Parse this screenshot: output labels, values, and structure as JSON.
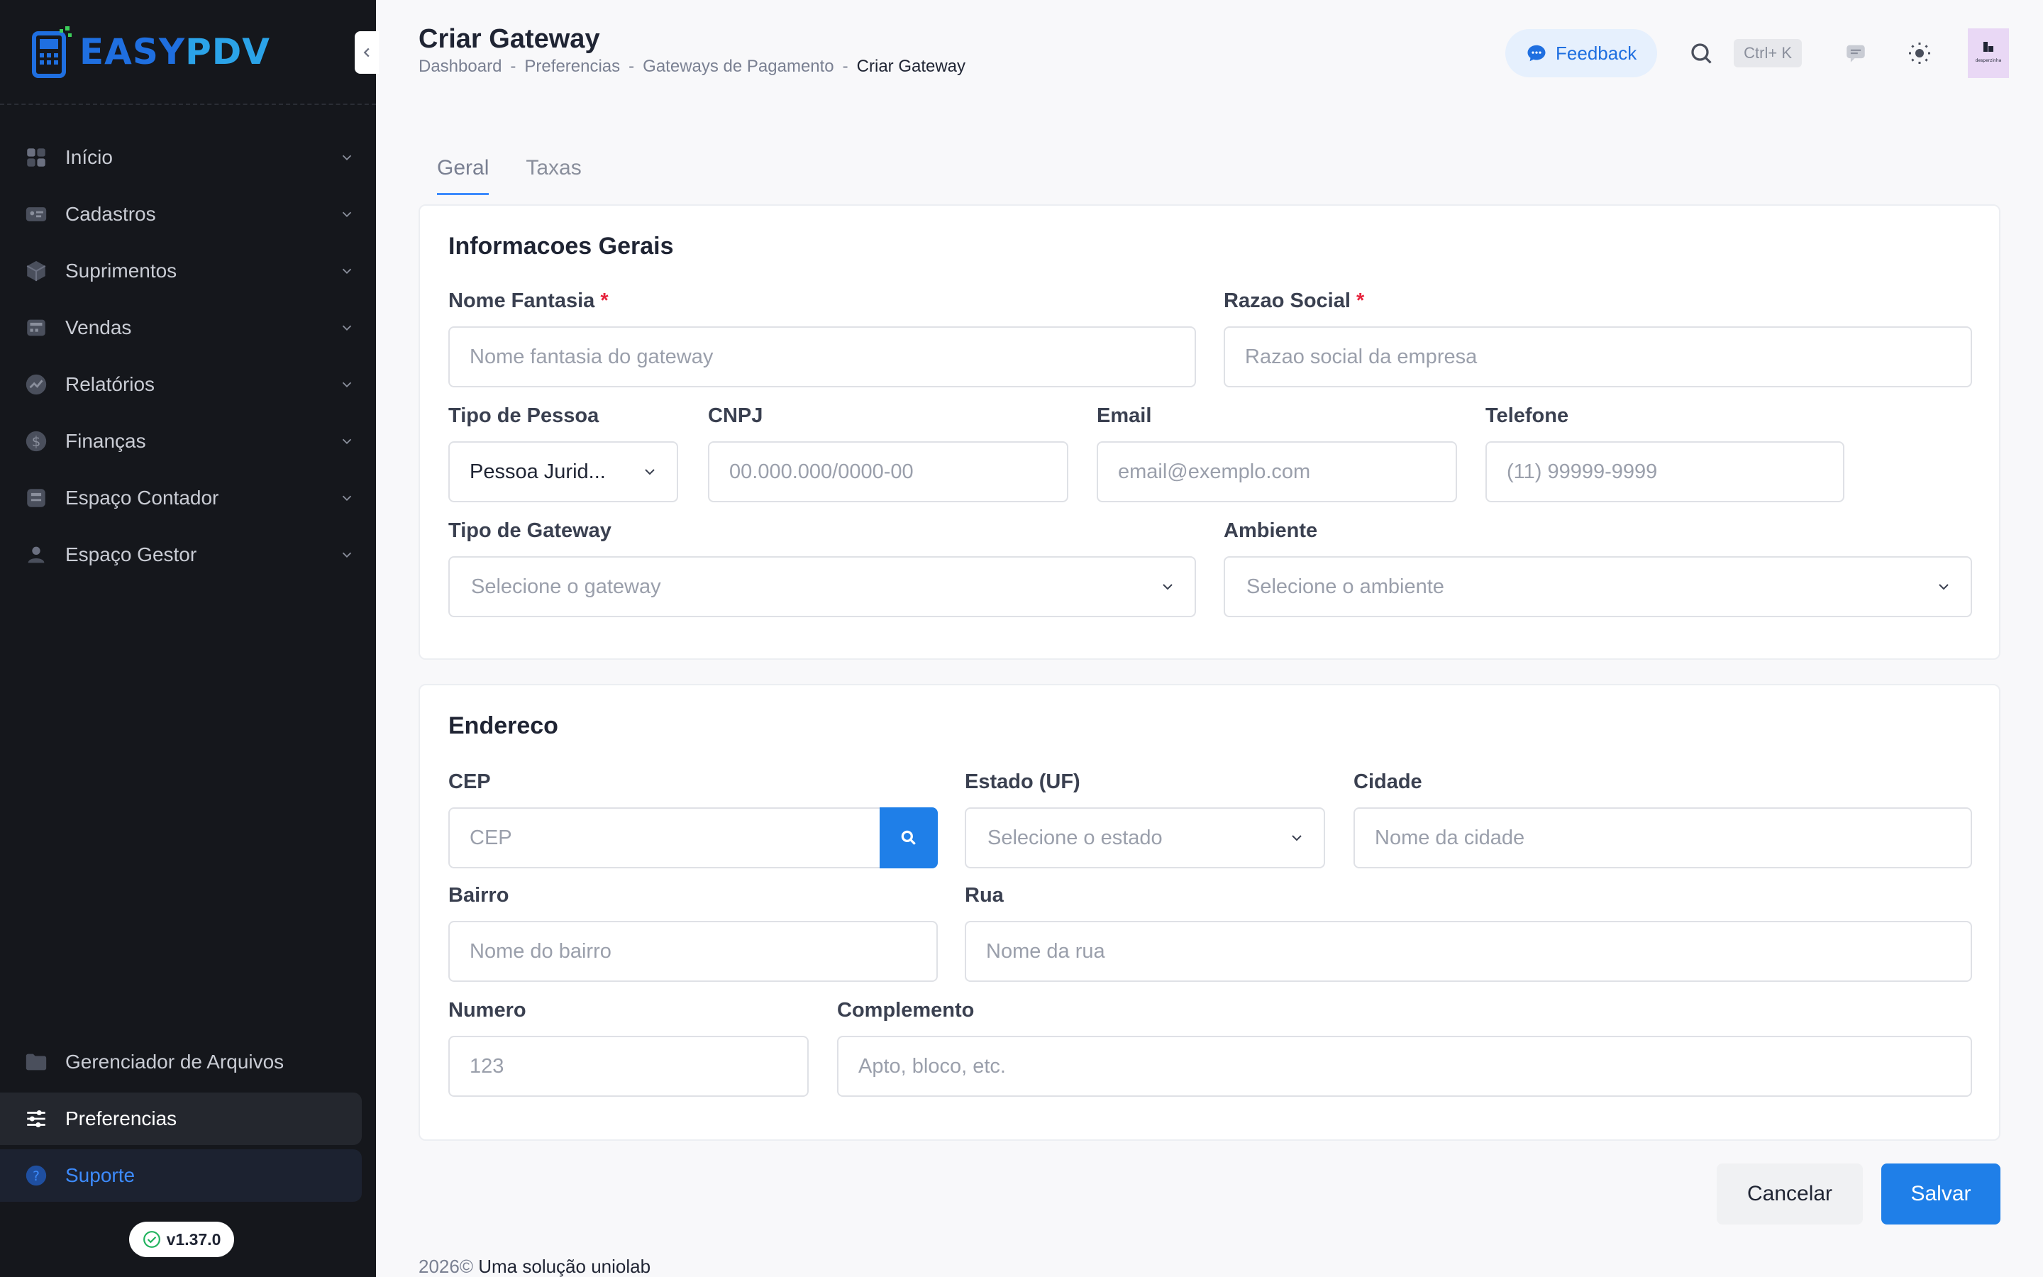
{
  "brand": {
    "part1": "EASY",
    "part2": "PDV"
  },
  "sidebar": {
    "items": [
      {
        "label": "Início",
        "icon": "grid-icon"
      },
      {
        "label": "Cadastros",
        "icon": "id-card-icon"
      },
      {
        "label": "Suprimentos",
        "icon": "box-icon"
      },
      {
        "label": "Vendas",
        "icon": "register-icon"
      },
      {
        "label": "Relatórios",
        "icon": "chart-icon"
      },
      {
        "label": "Finanças",
        "icon": "dollar-icon"
      },
      {
        "label": "Espaço Contador",
        "icon": "calculator-icon"
      },
      {
        "label": "Espaço Gestor",
        "icon": "user-pin-icon"
      }
    ],
    "bottom": [
      {
        "label": "Gerenciador de Arquivos",
        "icon": "folder-icon"
      },
      {
        "label": "Preferencias",
        "icon": "sliders-icon"
      },
      {
        "label": "Suporte",
        "icon": "help-icon"
      }
    ],
    "version": "v1.37.0"
  },
  "header": {
    "title": "Criar Gateway",
    "breadcrumb": [
      "Dashboard",
      "Preferencias",
      "Gateways de Pagamento",
      "Criar Gateway"
    ],
    "breadcrumb_sep": "-",
    "feedback_label": "Feedback",
    "shortcut": "Ctrl+ K",
    "avatar_text": "desperzinha"
  },
  "tabs": [
    "Geral",
    "Taxas"
  ],
  "general": {
    "title": "Informacoes Gerais",
    "nome_fantasia": {
      "label": "Nome Fantasia",
      "required": "*",
      "placeholder": "Nome fantasia do gateway"
    },
    "razao_social": {
      "label": "Razao Social",
      "required": "*",
      "placeholder": "Razao social da empresa"
    },
    "tipo_pessoa": {
      "label": "Tipo de Pessoa",
      "value": "Pessoa Jurid..."
    },
    "cnpj": {
      "label": "CNPJ",
      "placeholder": "00.000.000/0000-00"
    },
    "email": {
      "label": "Email",
      "placeholder": "email@exemplo.com"
    },
    "telefone": {
      "label": "Telefone",
      "placeholder": "(11) 99999-9999"
    },
    "tipo_gateway": {
      "label": "Tipo de Gateway",
      "placeholder": "Selecione o gateway"
    },
    "ambiente": {
      "label": "Ambiente",
      "placeholder": "Selecione o ambiente"
    }
  },
  "address": {
    "title": "Endereco",
    "cep": {
      "label": "CEP",
      "placeholder": "CEP"
    },
    "estado": {
      "label": "Estado (UF)",
      "placeholder": "Selecione o estado"
    },
    "cidade": {
      "label": "Cidade",
      "placeholder": "Nome da cidade"
    },
    "bairro": {
      "label": "Bairro",
      "placeholder": "Nome do bairro"
    },
    "rua": {
      "label": "Rua",
      "placeholder": "Nome da rua"
    },
    "numero": {
      "label": "Numero",
      "placeholder": "123"
    },
    "complemento": {
      "label": "Complemento",
      "placeholder": "Apto, bloco, etc."
    }
  },
  "actions": {
    "cancel": "Cancelar",
    "save": "Salvar"
  },
  "footer": {
    "year": "2026©",
    "text": "Uma solução uniolab"
  },
  "colors": {
    "primary": "#1f7fe8",
    "sidebar_bg": "#15171c",
    "required": "#e6243d"
  }
}
